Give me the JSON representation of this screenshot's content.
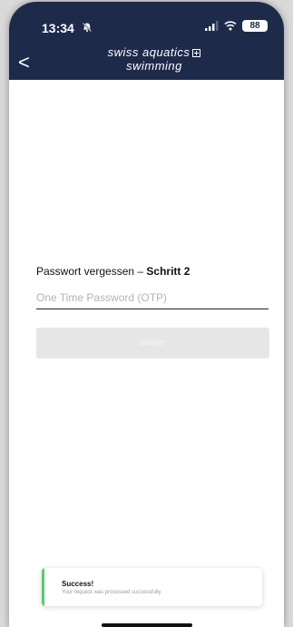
{
  "status_bar": {
    "time": "13:34",
    "battery": "88",
    "icons": [
      "silent-bell-icon",
      "signal-icon",
      "wifi-icon",
      "battery-icon"
    ]
  },
  "header": {
    "back_label": "<",
    "brand_line1": "swiss aquatics",
    "brand_line2": "swimming",
    "background": "#1e2a4a"
  },
  "form": {
    "title_prefix": "Passwort vergessen – ",
    "title_step": "Schritt 2",
    "otp_placeholder": "One Time Password (OTP)",
    "otp_value": "",
    "submit_label": "Weiter"
  },
  "toast": {
    "title": "Success!",
    "message": "Your request was processed successfully",
    "accent_color": "#4fcf6a"
  }
}
